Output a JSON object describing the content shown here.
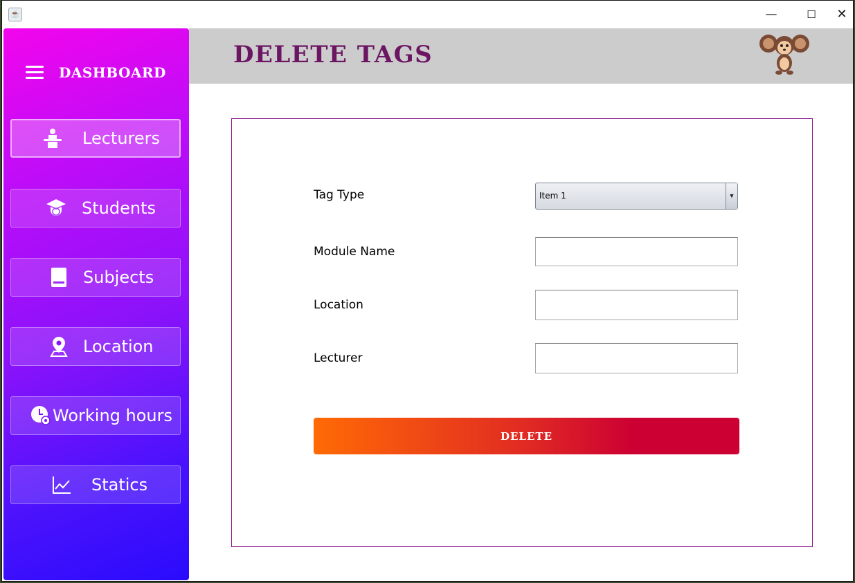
{
  "window": {
    "minimize_glyph": "—",
    "maximize_glyph": "☐",
    "close_glyph": "✕",
    "app_icon": "java-icon"
  },
  "sidebar": {
    "title": "DASHBOARD",
    "items": [
      {
        "label": "Lecturers",
        "icon": "lecturer-podium-icon",
        "active": true
      },
      {
        "label": "Students",
        "icon": "graduate-icon",
        "active": false
      },
      {
        "label": "Subjects",
        "icon": "book-icon",
        "active": false
      },
      {
        "label": "Location",
        "icon": "map-pin-icon",
        "active": false
      },
      {
        "label": "Working hours",
        "icon": "clock-gear-icon",
        "active": false
      },
      {
        "label": "Statics",
        "icon": "line-chart-icon",
        "active": false
      }
    ]
  },
  "header": {
    "title": "DELETE TAGS",
    "mascot_icon": "cheburashka-mascot-icon"
  },
  "form": {
    "tag_type_label": "Tag Type",
    "tag_type_value": "Item 1",
    "module_name_label": "Module Name",
    "module_name_value": "",
    "location_label": "Location",
    "location_value": "",
    "lecturer_label": "Lecturer",
    "lecturer_value": "",
    "delete_label": "DELETE"
  },
  "colors": {
    "sidebar_gradient_top": "#f205ec",
    "sidebar_gradient_bottom": "#2a0bfd",
    "title_color": "#6b1563",
    "header_bg": "#cccccc",
    "delete_gradient_start": "#ff6a05",
    "delete_gradient_end": "#cc0033",
    "panel_border": "#8b1a8b"
  }
}
